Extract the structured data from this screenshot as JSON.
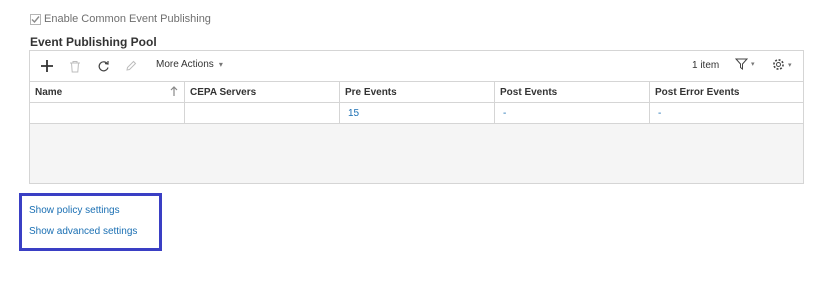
{
  "enable_publishing": {
    "label": "Enable Common Event Publishing",
    "checked": true
  },
  "pool": {
    "title": "Event Publishing Pool",
    "toolbar": {
      "more_actions_label": "More Actions",
      "item_count": "1 item",
      "icons": [
        "plus-icon",
        "trash-icon",
        "refresh-icon",
        "pencil-icon",
        "filter-icon",
        "gear-icon"
      ]
    },
    "columns": [
      "Name",
      "CEPA Servers",
      "Pre Events",
      "Post Events",
      "Post Error Events"
    ],
    "rows": [
      {
        "name": "",
        "cepa_servers": "",
        "pre_events": "15",
        "post_events": "-",
        "post_error_events": "-"
      }
    ]
  },
  "links": {
    "policy": "Show policy settings",
    "advanced": "Show advanced settings"
  },
  "colors": {
    "link": "#1a6fb3",
    "highlight_border": "#3a3fc4",
    "grid_border": "#d5d5d5"
  }
}
